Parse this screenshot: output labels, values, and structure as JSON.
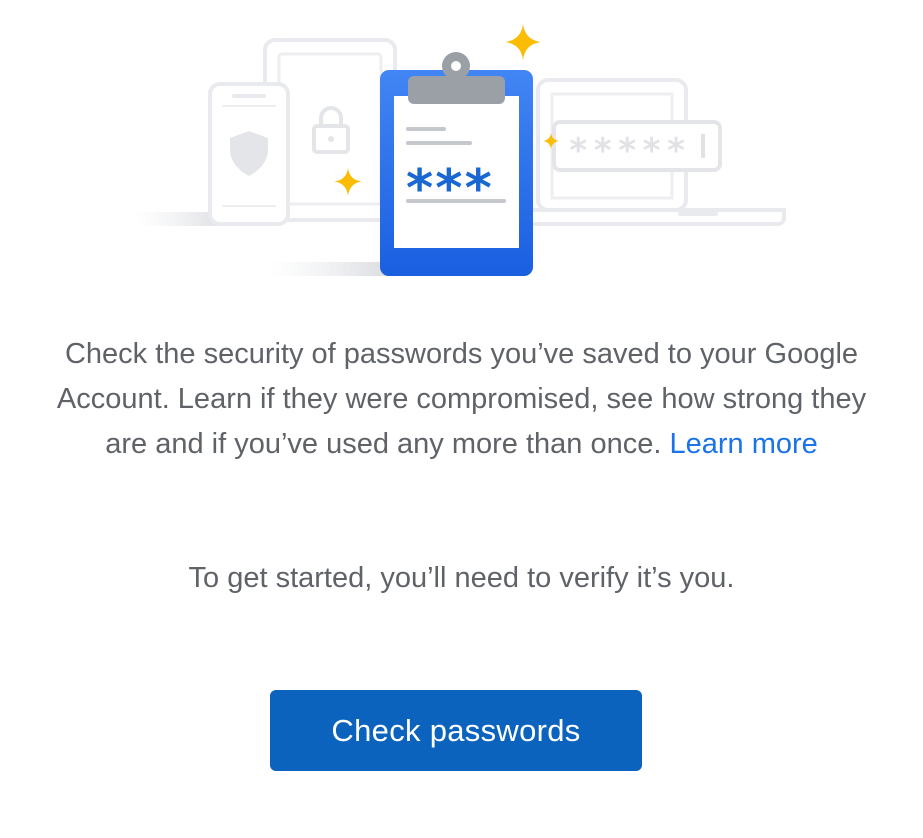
{
  "description": {
    "text": "Check the security of passwords you’ve saved to your Google Account. Learn if they were compromised, see how strong they are and if you’ve used any more than once.",
    "link_label": "Learn more"
  },
  "verify_text": "To get started, you’ll need to verify it’s you.",
  "button": {
    "label": "Check passwords"
  },
  "illustration": {
    "masked_password": "*****",
    "clipboard_masked": "***",
    "colors": {
      "clipboard_blue": "#1a73e8",
      "asterisk_blue": "#1967d2",
      "sparkle_yellow": "#fbbc04",
      "device_outline": "#e8eaed",
      "clip_gray": "#9aa0a6"
    }
  }
}
